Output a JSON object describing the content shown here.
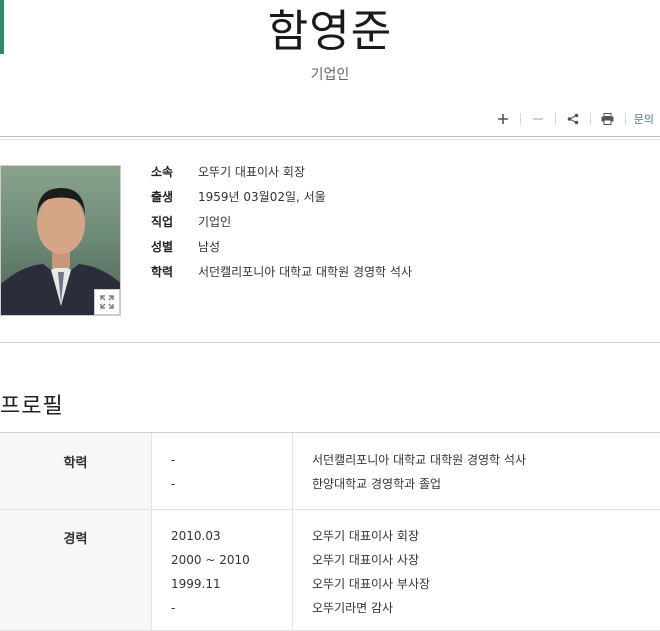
{
  "person": {
    "name": "함영준",
    "occupation_subtitle": "기업인"
  },
  "toolbar": {
    "zoom_in": "plus-icon",
    "zoom_out": "minus-icon",
    "share": "share-icon",
    "print": "print-icon",
    "inquiry_label": "문의"
  },
  "info": [
    {
      "label": "소속",
      "value": "오뚜기 대표이사 회장"
    },
    {
      "label": "출생",
      "value": "1959년 03월02일, 서울"
    },
    {
      "label": "직업",
      "value": "기업인"
    },
    {
      "label": "성별",
      "value": "남성"
    },
    {
      "label": "학력",
      "value": "서던캘리포니아 대학교 대학원 경영학 석사"
    }
  ],
  "profile": {
    "section_title": "프로필",
    "education": {
      "label": "학력",
      "entries": [
        {
          "date": "-",
          "content": "서던캘리포니아 대학교 대학원 경영학 석사"
        },
        {
          "date": "-",
          "content": "한양대학교 경영학과 졸업"
        }
      ]
    },
    "career": {
      "label": "경력",
      "entries": [
        {
          "date": "2010.03",
          "content": "오뚜기 대표이사 회장"
        },
        {
          "date": "2000 ~ 2010",
          "content": "오뚜기 대표이사 사장"
        },
        {
          "date": "1999.11",
          "content": "오뚜기 대표이사 부사장"
        },
        {
          "date": "-",
          "content": "오뚜기라면 감사"
        }
      ]
    }
  },
  "colors": {
    "accent": "#2e8b6a",
    "link": "#55789c"
  }
}
